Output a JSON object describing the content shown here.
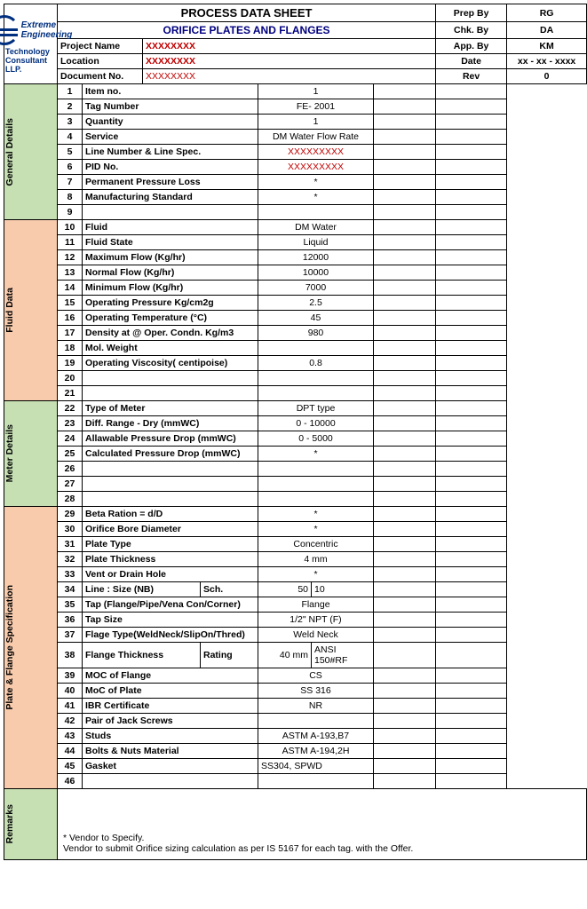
{
  "header": {
    "title_main": "PROCESS DATA SHEET",
    "title_sub": "ORIFICE PLATES AND FLANGES",
    "logo_line1": "Extreme",
    "logo_line2": "Engineering",
    "logo_line3": "Technology Consultant LLP.",
    "project_name_label": "Project Name",
    "project_name_value": "XXXXXXXX",
    "location_label": "Location",
    "location_value": "XXXXXXXX",
    "docno_label": "Document No.",
    "docno_value": "XXXXXXXX",
    "prep_by_label": "Prep By",
    "prep_by_value": "RG",
    "chk_by_label": "Chk. By",
    "chk_by_value": "DA",
    "app_by_label": "App. By",
    "app_by_value": "KM",
    "date_label": "Date",
    "date_value": "xx - xx - xxxx",
    "rev_label": "Rev",
    "rev_value": "0"
  },
  "sections": {
    "general": "General Details",
    "fluid": "Fluid Data",
    "meter": "Meter Details",
    "plate": "Plate & Flange Specification",
    "remarks": "Remarks"
  },
  "rows": [
    {
      "n": "1",
      "label": "Item no.",
      "v1": "1"
    },
    {
      "n": "2",
      "label": "Tag Number",
      "v1": "FE- 2001"
    },
    {
      "n": "3",
      "label": "Quantity",
      "v1": "1"
    },
    {
      "n": "4",
      "label": "Service",
      "v1": "DM Water Flow Rate"
    },
    {
      "n": "5",
      "label": "Line Number & Line Spec.",
      "v1": "XXXXXXXXX",
      "red": true
    },
    {
      "n": "6",
      "label": "PID No.",
      "v1": "XXXXXXXXX",
      "red": true
    },
    {
      "n": "7",
      "label": "Permanent Pressure Loss",
      "v1": "*"
    },
    {
      "n": "8",
      "label": "Manufacturing Standard",
      "v1": "*"
    },
    {
      "n": "9",
      "label": "",
      "v1": ""
    },
    {
      "n": "10",
      "label": "Fluid",
      "v1": "DM Water"
    },
    {
      "n": "11",
      "label": "Fluid State",
      "v1": "Liquid"
    },
    {
      "n": "12",
      "label": "Maximum Flow (Kg/hr)",
      "v1": "12000"
    },
    {
      "n": "13",
      "label": "Normal Flow (Kg/hr)",
      "v1": "10000"
    },
    {
      "n": "14",
      "label": "Minimum Flow (Kg/hr)",
      "v1": "7000"
    },
    {
      "n": "15",
      "label": "Operating Pressure Kg/cm2g",
      "v1": "2.5"
    },
    {
      "n": "16",
      "label": "Operating Temperature (°C)",
      "v1": "45"
    },
    {
      "n": "17",
      "label": "Density at @ Oper. Condn. Kg/m3",
      "v1": "980"
    },
    {
      "n": "18",
      "label": "Mol. Weight",
      "v1": ""
    },
    {
      "n": "19",
      "label": "Operating Viscosity( centipoise)",
      "v1": "0.8"
    },
    {
      "n": "20",
      "label": "",
      "v1": ""
    },
    {
      "n": "21",
      "label": "",
      "v1": ""
    },
    {
      "n": "22",
      "label": "Type of Meter",
      "v1": "DPT type"
    },
    {
      "n": "23",
      "label": "Diff. Range - Dry (mmWC)",
      "v1": "0 - 10000"
    },
    {
      "n": "24",
      "label": "Allawable Pressure Drop (mmWC)",
      "v1": "0 - 5000"
    },
    {
      "n": "25",
      "label": "Calculated Pressure Drop (mmWC)",
      "v1": "*"
    },
    {
      "n": "26",
      "label": "",
      "v1": ""
    },
    {
      "n": "27",
      "label": "",
      "v1": ""
    },
    {
      "n": "28",
      "label": "",
      "v1": ""
    },
    {
      "n": "29",
      "label": "Beta Ration  = d/D",
      "v1": "*"
    },
    {
      "n": "30",
      "label": "Orifice Bore Diameter",
      "v1": "*"
    },
    {
      "n": "31",
      "label": "Plate Type",
      "v1": "Concentric"
    },
    {
      "n": "32",
      "label": "Plate Thickness",
      "v1": "4 mm"
    },
    {
      "n": "33",
      "label": "Vent or Drain Hole",
      "v1": "*"
    },
    {
      "n": "34",
      "label": "Line :  Size (NB)",
      "label2": "Sch.",
      "v1": "50",
      "v2": "10",
      "split": true
    },
    {
      "n": "35",
      "label": "Tap (Flange/Pipe/Vena Con/Corner)",
      "v1": "Flange"
    },
    {
      "n": "36",
      "label": "Tap Size",
      "v1": "1/2\" NPT (F)"
    },
    {
      "n": "37",
      "label": "Flage Type(WeldNeck/SlipOn/Thred)",
      "v1": "Weld Neck"
    },
    {
      "n": "38",
      "label": "Flange Thickness",
      "label2": "Rating",
      "v1": "40 mm",
      "v2": "ANSI 150#RF",
      "split": true
    },
    {
      "n": "39",
      "label": "MOC of Flange",
      "v1": "CS"
    },
    {
      "n": "40",
      "label": "MoC of Plate",
      "v1": "SS 316"
    },
    {
      "n": "41",
      "label": "IBR Certificate",
      "v1": "NR"
    },
    {
      "n": "42",
      "label": "Pair of Jack Screws",
      "v1": ""
    },
    {
      "n": "43",
      "label": "Studs",
      "v1": "ASTM A-193,B7"
    },
    {
      "n": "44",
      "label": "Bolts & Nuts Material",
      "v1": "ASTM A-194,2H"
    },
    {
      "n": "45",
      "label": "Gasket",
      "v1": "SS304, SPWD",
      "left": true
    },
    {
      "n": "46",
      "label": "",
      "v1": ""
    }
  ],
  "remarks": {
    "l1": "* Vendor to Specify.",
    "l2": "Vendor to submit Orifice sizing calculation as per IS 5167 for each tag. with the Offer."
  }
}
